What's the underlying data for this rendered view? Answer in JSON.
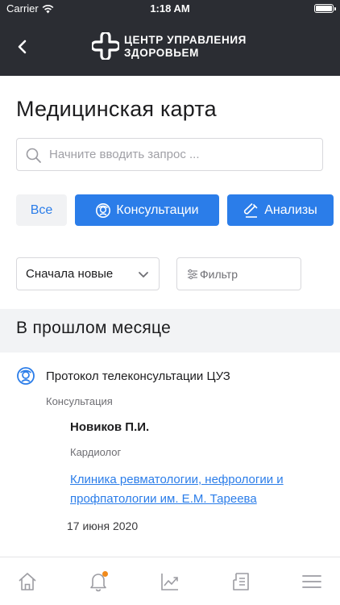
{
  "status_bar": {
    "carrier": "Carrier",
    "time": "1:18 AM"
  },
  "header": {
    "brand_line1": "ЦЕНТР УПРАВЛЕНИЯ",
    "brand_line2": "ЗДОРОВЬЕМ"
  },
  "page": {
    "title": "Медицинская карта"
  },
  "search": {
    "placeholder": "Начните вводить запрос ...",
    "value": ""
  },
  "filters": {
    "all": "Все",
    "consultations": "Консультации",
    "analyses": "Анализы"
  },
  "sort": {
    "selected": "Сначала новые"
  },
  "filter_button": {
    "label": "Фильтр"
  },
  "section": {
    "title": "В прошлом месяце"
  },
  "record": {
    "title": "Протокол телеконсультации ЦУЗ",
    "type": "Консультация",
    "doctor": "Новиков П.И.",
    "specialty": "Кардиолог",
    "clinic": "Клиника ревматологии, нефрологии и профпатологии им. Е.М. Тареева",
    "date": "17 июня 2020"
  },
  "tab_bar": {
    "items": [
      "home-icon",
      "bell-icon",
      "chart-icon",
      "document-icon",
      "menu-icon"
    ]
  },
  "colors": {
    "header_bg": "#2b2d33",
    "accent": "#2b7de9",
    "notification_dot": "#f08a1c",
    "section_bg": "#f2f3f5"
  }
}
